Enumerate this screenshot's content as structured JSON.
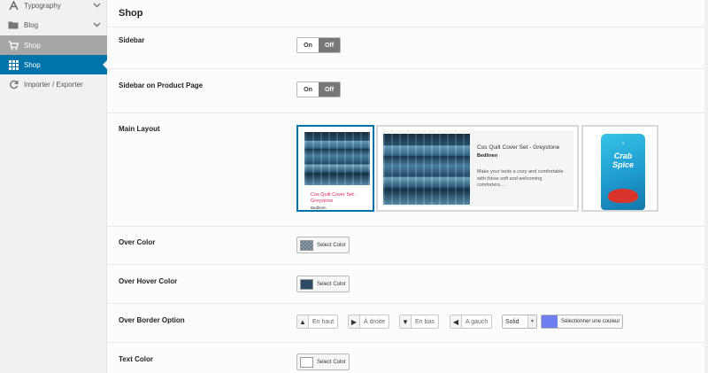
{
  "sidebar": {
    "items": [
      {
        "label": "Typography",
        "icon": "font-icon",
        "chevron": "chevron-down-icon"
      },
      {
        "label": "Blog",
        "icon": "folder-icon",
        "chevron": "chevron-down-icon"
      },
      {
        "label": "Shop",
        "icon": "cart-icon",
        "state": "parent-open"
      },
      {
        "label": "Shop",
        "icon": "grid-icon",
        "state": "active"
      },
      {
        "label": "Importer / Exporter",
        "icon": "refresh-icon"
      }
    ]
  },
  "main": {
    "title": "Shop",
    "sidebar_row": {
      "label": "Sidebar",
      "on": "On",
      "off": "Off",
      "value": "Off"
    },
    "sidebar_product_row": {
      "label": "Sidebar on Product Page",
      "on": "On",
      "off": "Off",
      "value": "Off"
    },
    "main_layout": {
      "label": "Main Layout",
      "options": [
        {
          "product_name": "Cos Quilt Cover Set - Greystone",
          "category": "Bedlinen",
          "selected": true
        },
        {
          "product_name": "Cos Quilt Cover Set - Greystone",
          "category": "Bedlinen",
          "description": "Make your beds a cozy and comfortable with these soft and welcoming comforters....",
          "selected": false
        },
        {
          "product_text": "Crab Spice",
          "selected": false
        }
      ]
    },
    "over_color": {
      "label": "Over Color",
      "button": "Select Color",
      "swatch": "#7a8a99"
    },
    "over_hover_color": {
      "label": "Over Hover Color",
      "button": "Select Color",
      "swatch": "#2e4a66"
    },
    "over_border_option": {
      "label": "Over Border Option",
      "top": "En haut",
      "right": "À droite",
      "bottom": "En bas",
      "left": "A gauch",
      "style": "Solid",
      "color_button": "Sélectionner une couleur",
      "swatch": "#6f7ff2"
    },
    "text_color": {
      "label": "Text Color",
      "button": "Select Color",
      "swatch": "#ffffff"
    }
  }
}
